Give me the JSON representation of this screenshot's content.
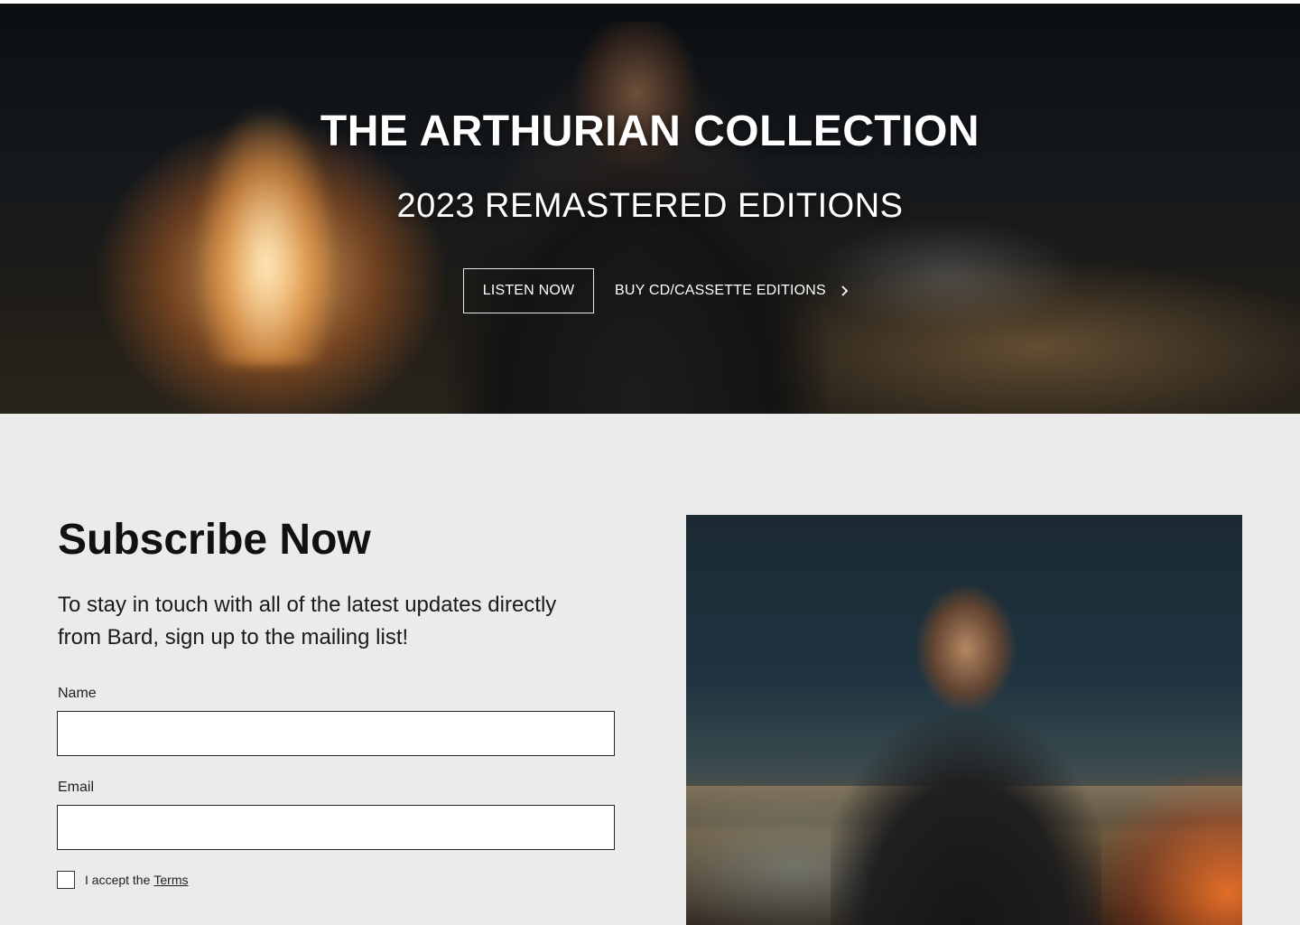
{
  "hero": {
    "title": "THE ARTHURIAN COLLECTION",
    "subtitle": "2023 REMASTERED EDITIONS",
    "primary_button": "LISTEN NOW",
    "secondary_link": "BUY CD/CASSETTE EDITIONS",
    "secondary_icon": "chevron-right-icon"
  },
  "subscribe": {
    "title": "Subscribe Now",
    "description": "To stay in touch with all of the latest updates directly from Bard, sign up to the mailing list!",
    "name_label": "Name",
    "name_value": "",
    "email_label": "Email",
    "email_value": "",
    "terms_prefix": "I accept the",
    "terms_link": "Terms"
  },
  "colors": {
    "page_background": "#ebebeb",
    "text": "#111111",
    "hero_text": "#ffffff"
  }
}
